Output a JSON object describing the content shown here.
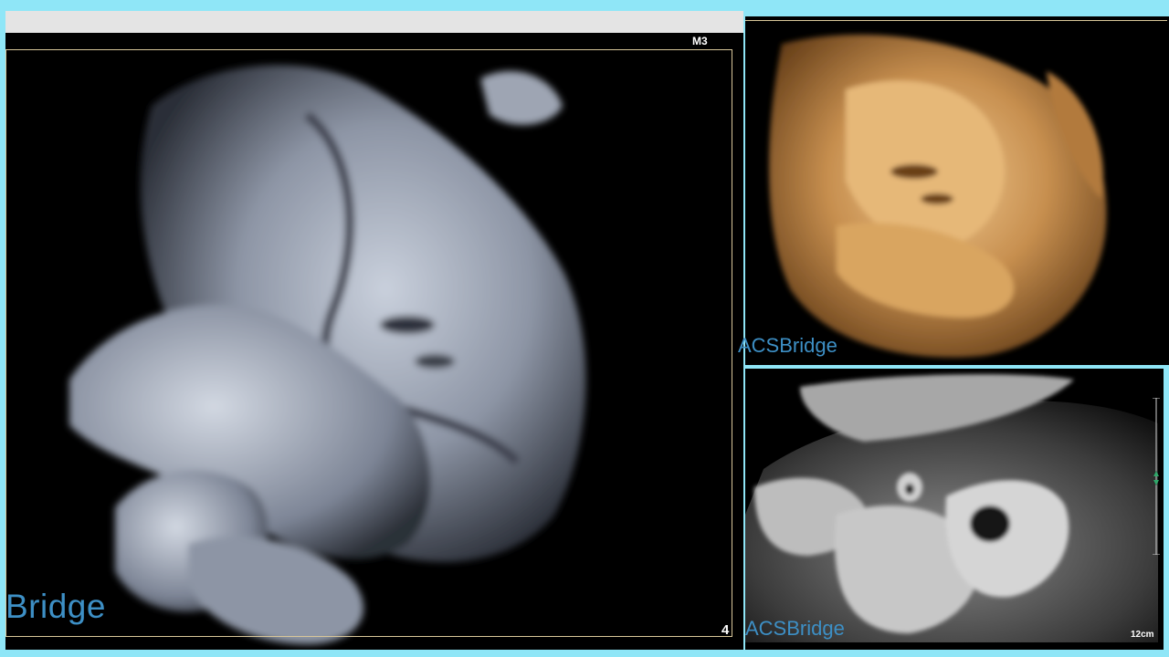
{
  "left_panel": {
    "mode_label": "M3",
    "index_label": "4",
    "watermark": "Bridge"
  },
  "right_top_panel": {
    "watermark": "ACSBridge"
  },
  "right_bottom_panel": {
    "watermark": "ACSBridge",
    "depth_label": "12cm"
  },
  "colors": {
    "page_border": "#8fe6f7",
    "frame": "#d9c79a",
    "watermark": "#3d8fc5",
    "scale_marker": "#2fa86a"
  }
}
